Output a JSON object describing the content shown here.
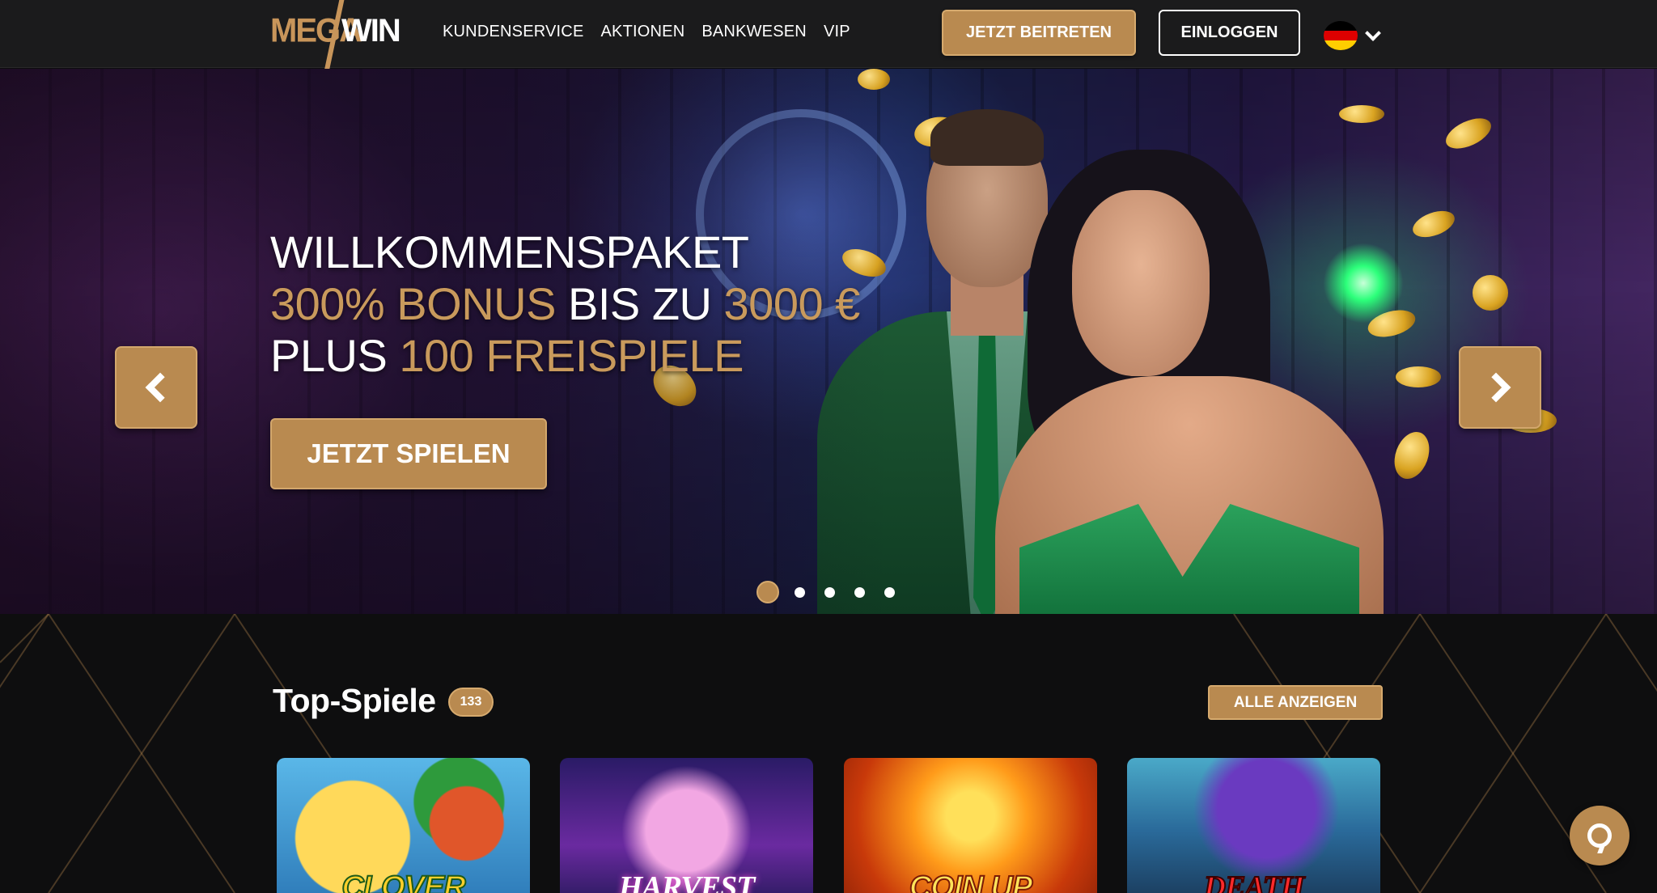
{
  "header": {
    "logo": {
      "mega": "MEGA",
      "win": "WIN"
    },
    "nav": [
      "KUNDENSERVICE",
      "AKTIONEN",
      "BANKWESEN",
      "VIP"
    ],
    "join_label": "JETZT BEITRETEN",
    "login_label": "EINLOGGEN",
    "language_icon": "flag-de-icon",
    "flag_colors": [
      "#000000",
      "#dd0000",
      "#ffce00"
    ]
  },
  "hero": {
    "line1": "WILLKOMMENSPAKET",
    "line2_a": "300% BONUS",
    "line2_b": " BIS ZU ",
    "line2_c": "3000 €",
    "line3_a": "PLUS ",
    "line3_b": "100 FREISPIELE",
    "cta_label": "JETZT SPIELEN",
    "slides_total": 5,
    "active_slide": 1
  },
  "top_games": {
    "title": "Top-Spiele",
    "count": "133",
    "view_all_label": "ALLE ANZEIGEN",
    "games": [
      {
        "title": "CLOVER"
      },
      {
        "title": "HARVEST"
      },
      {
        "title": "COIN UP"
      },
      {
        "title": "DEATH"
      }
    ]
  },
  "colors": {
    "accent_gold": "#b98a50",
    "header_bg": "#1b1b1c",
    "page_bg": "#0e0e0f",
    "hero_gold_text": "#c99a5c"
  },
  "chat": {
    "icon": "chat-bubble-icon"
  }
}
